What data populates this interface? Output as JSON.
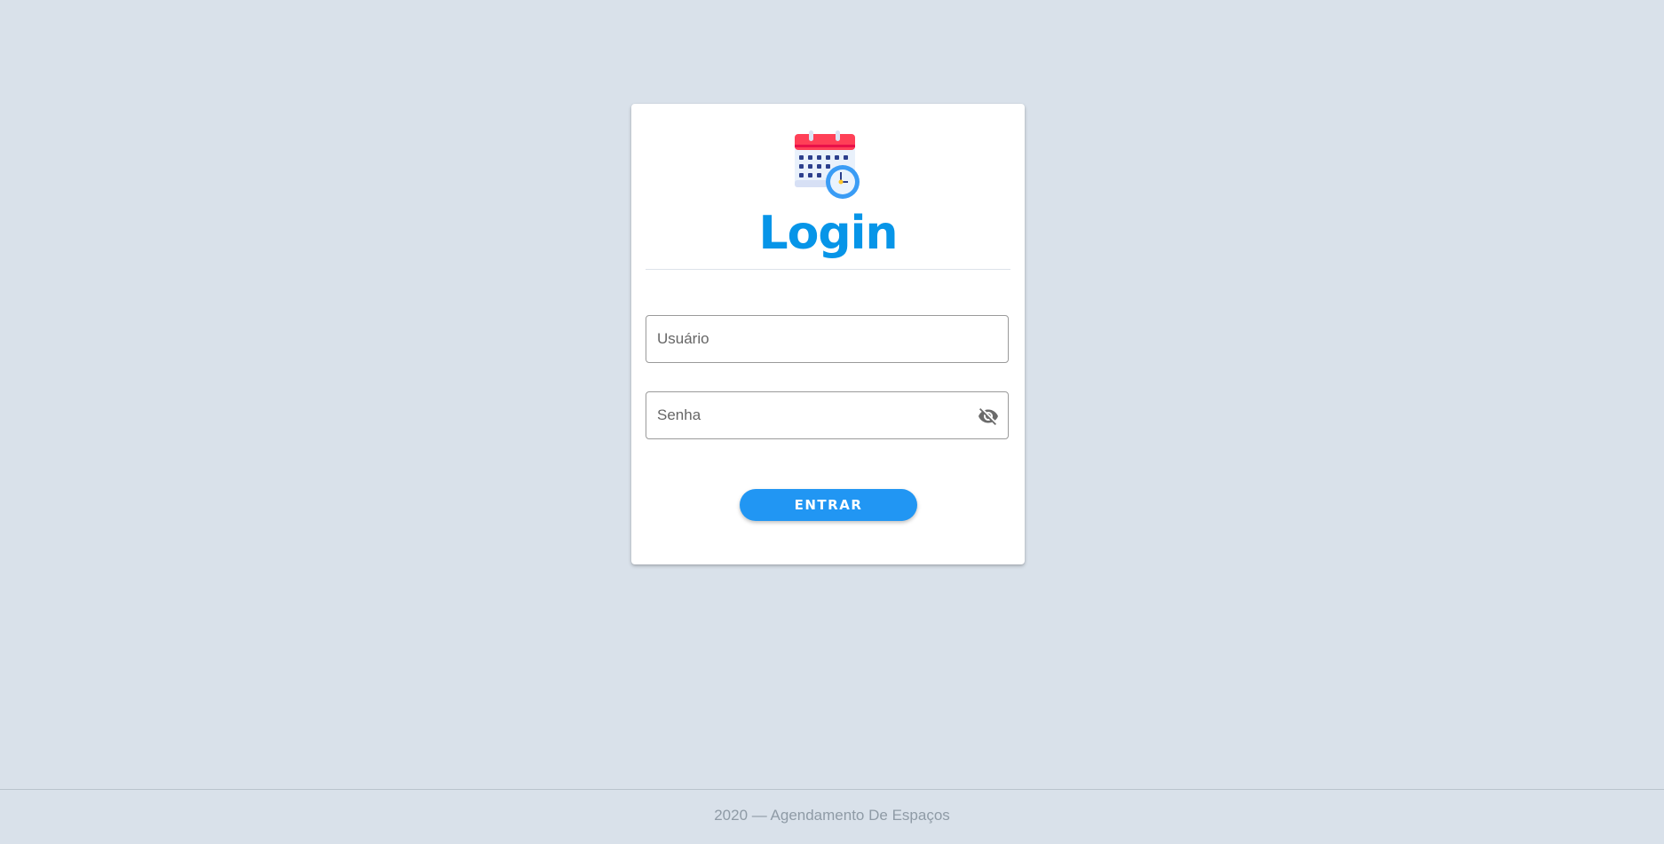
{
  "login": {
    "title": "Login",
    "username_placeholder": "Usuário",
    "password_placeholder": "Senha",
    "submit_label": "ENTRAR"
  },
  "footer": {
    "text": "2020 — Agendamento De Espaços"
  },
  "colors": {
    "accent": "#2196f3",
    "title": "#0795e8",
    "background": "#d9e1ea"
  }
}
